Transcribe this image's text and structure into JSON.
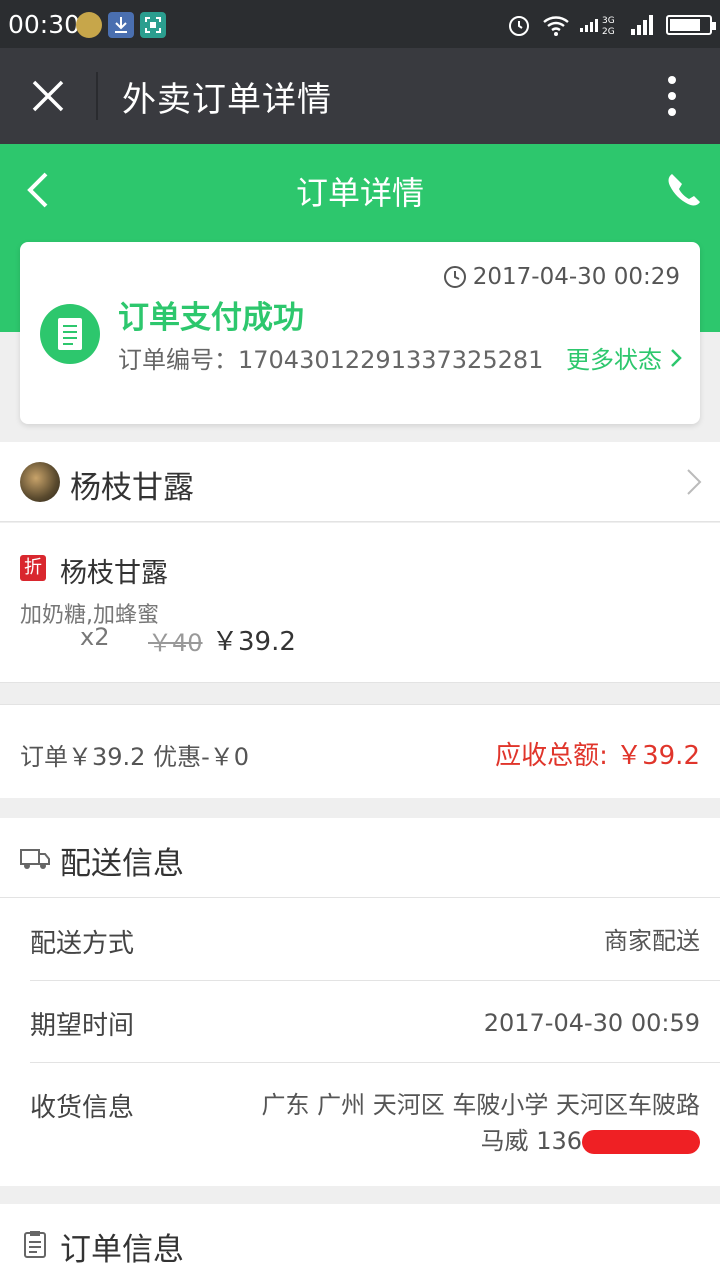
{
  "status_bar": {
    "time": "00:30",
    "signal_labels": [
      "3G",
      "2G"
    ],
    "battery_level": 0.8
  },
  "title_bar": {
    "title": "外卖订单详情"
  },
  "header": {
    "title": "订单详情"
  },
  "order_card": {
    "timestamp": "2017-04-30 00:29",
    "status": "订单支付成功",
    "order_no_label": "订单编号：",
    "order_no": "170430122913373252​81",
    "more_status": "更多状态"
  },
  "shop": {
    "name": "杨枝甘露"
  },
  "item": {
    "tag": "折",
    "name": "杨枝甘露",
    "spec": "加奶糖,加蜂蜜",
    "qty": "x2",
    "orig_price": "￥40",
    "price": "￥39.2"
  },
  "summary": {
    "left": "订单￥39.2 优惠-￥0",
    "right": "应收总额: ￥39.2"
  },
  "delivery": {
    "title": "配送信息",
    "rows": [
      {
        "key": "配送方式",
        "value": "商家配送"
      },
      {
        "key": "期望时间",
        "value": "2017-04-30 00:59"
      },
      {
        "key": "收货信息",
        "value": "广东 广州 天河区 车陂小学 天河区车陂路",
        "value2": "马威 136"
      }
    ]
  },
  "order_info": {
    "title": "订单信息"
  },
  "colors": {
    "brand_green": "#2dc76d",
    "price_red": "#e0352b",
    "dark_bar": "#393a3f"
  }
}
